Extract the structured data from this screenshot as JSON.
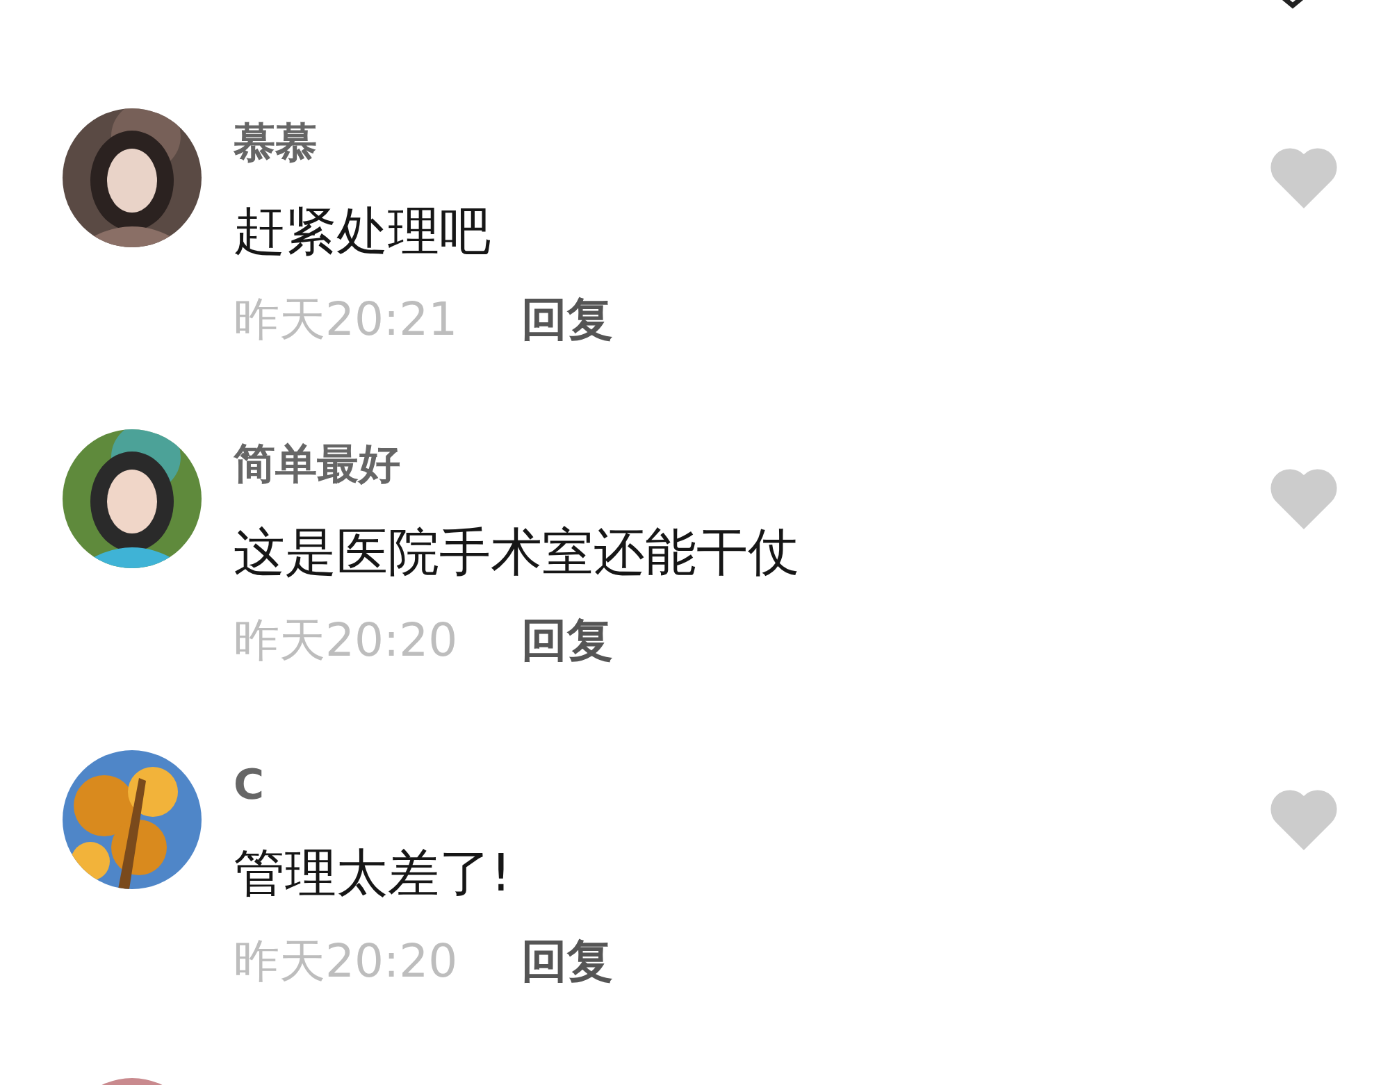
{
  "comments": [
    {
      "name": "慕慕",
      "text": "赶紧处理吧",
      "time": "昨天20:21",
      "reply": "回复",
      "liked": false
    },
    {
      "name": "简单最好",
      "text": "这是医院手术室还能干仗",
      "time": "昨天20:20",
      "reply": "回复",
      "liked": false
    },
    {
      "name": "C",
      "text": "管理太差了!",
      "time": "昨天20:20",
      "reply": "回复",
      "liked": false
    }
  ]
}
